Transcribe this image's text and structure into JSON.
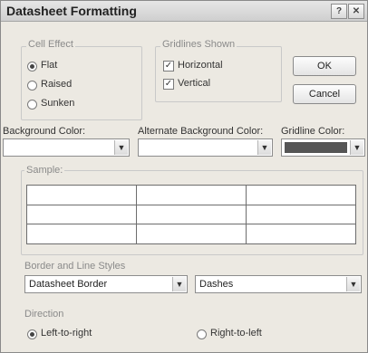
{
  "title": "Datasheet Formatting",
  "title_buttons": {
    "help": "?",
    "close": "✕"
  },
  "cell_effect": {
    "label": "Cell Effect",
    "options": [
      "Flat",
      "Raised",
      "Sunken"
    ],
    "selected": "Flat"
  },
  "gridlines": {
    "label": "Gridlines Shown",
    "horizontal": {
      "label": "Horizontal",
      "checked": true
    },
    "vertical": {
      "label": "Vertical",
      "checked": true
    }
  },
  "buttons": {
    "ok": "OK",
    "cancel": "Cancel"
  },
  "colors": {
    "background_label": "Background Color:",
    "alternate_label": "Alternate Background Color:",
    "gridline_label": "Gridline Color:",
    "gridline_value": "#555555"
  },
  "sample_label": "Sample:",
  "border_styles": {
    "label": "Border and Line Styles",
    "border_value": "Datasheet Border",
    "line_value": "Dashes"
  },
  "direction": {
    "label": "Direction",
    "options": [
      "Left-to-right",
      "Right-to-left"
    ],
    "selected": "Left-to-right"
  }
}
